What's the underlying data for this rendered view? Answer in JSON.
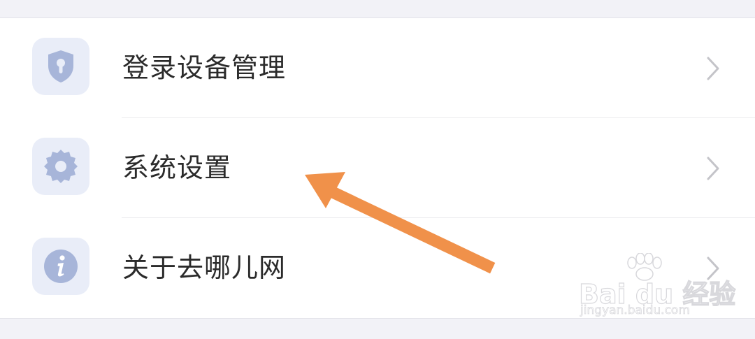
{
  "menu": {
    "items": [
      {
        "label": "登录设备管理",
        "icon": "shield-keyhole-icon"
      },
      {
        "label": "系统设置",
        "icon": "gear-icon"
      },
      {
        "label": "关于去哪儿网",
        "icon": "info-icon"
      }
    ]
  },
  "annotation": {
    "arrow_color": "#f0914a",
    "points_to": "系统设置"
  },
  "watermark": {
    "brand": "Bai du 经验",
    "url": "jingyan.baidu.com"
  },
  "colors": {
    "icon_fill": "#a7b5d9",
    "icon_tile_bg": "#e9edf8",
    "label_text": "#2b2b2b",
    "chevron": "#c4c4c9",
    "page_bg": "#f2f2f7"
  }
}
